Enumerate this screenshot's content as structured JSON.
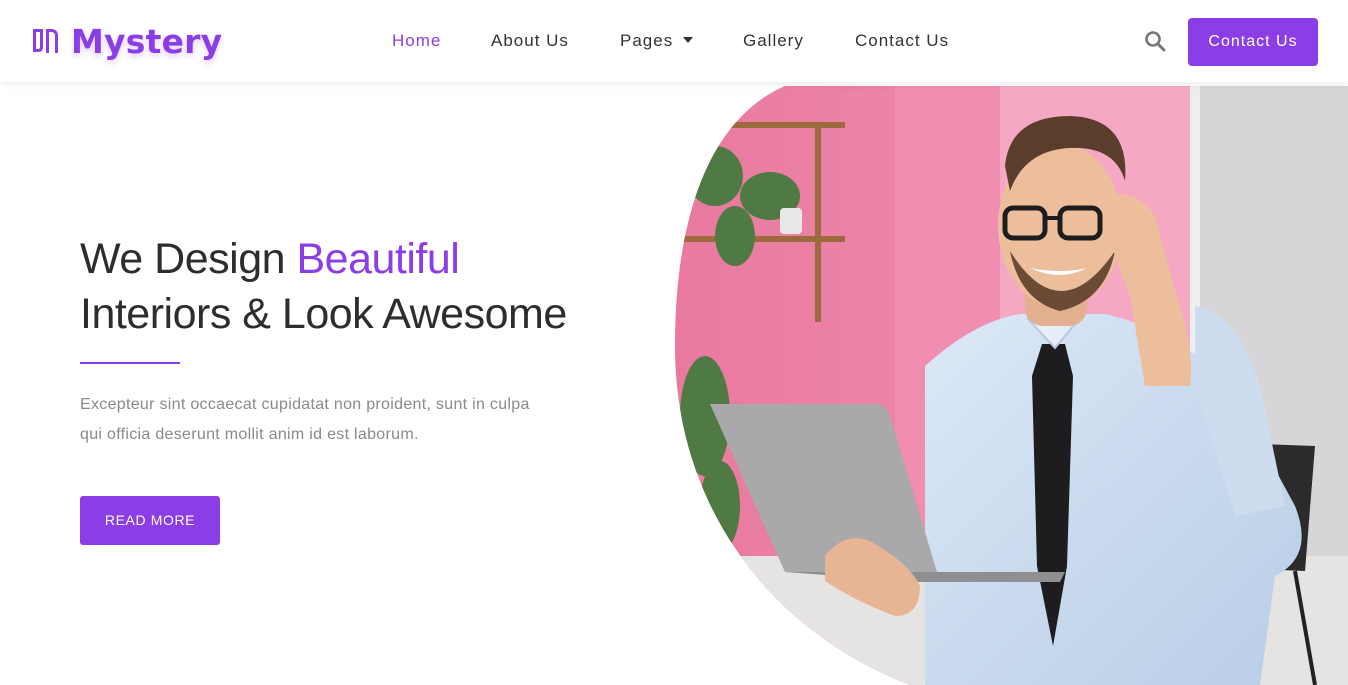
{
  "brand": {
    "name": "Mystery",
    "logo_icon": "brand-logo-icon",
    "color": "#8b3de6"
  },
  "nav": {
    "items": [
      {
        "label": "Home",
        "active": true
      },
      {
        "label": "About Us",
        "active": false
      },
      {
        "label": "Pages",
        "active": false,
        "dropdown": true
      },
      {
        "label": "Gallery",
        "active": false
      },
      {
        "label": "Contact Us",
        "active": false
      }
    ],
    "search_icon": "search-icon",
    "cta_label": "Contact Us"
  },
  "hero": {
    "title_line1": "We Design ",
    "title_accent": "Beautiful",
    "title_line2": "Interiors & Look Awesome",
    "text_line1": "Excepteur sint occaecat cupidatat non proident, sunt in culpa",
    "text_line2": "qui officia deserunt mollit anim id est laborum.",
    "button_label": "READ MORE"
  },
  "colors": {
    "accent": "#8b3de6",
    "heading": "#2d2d2d",
    "body_text": "#8a8a8a",
    "nav_text": "#333333"
  }
}
